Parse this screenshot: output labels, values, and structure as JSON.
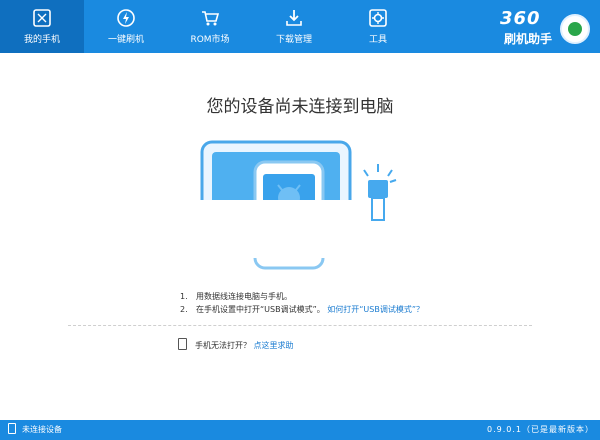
{
  "nav": {
    "tabs": [
      {
        "label": "我的手机",
        "icon": "phone-icon",
        "active": true
      },
      {
        "label": "一键刷机",
        "icon": "flash-icon",
        "active": false
      },
      {
        "label": "ROM市场",
        "icon": "cart-icon",
        "active": false
      },
      {
        "label": "下载管理",
        "icon": "download-icon",
        "active": false
      },
      {
        "label": "工具",
        "icon": "tools-icon",
        "active": false
      }
    ]
  },
  "brand": {
    "number": "360",
    "name": "刷机助手",
    "icon": "logo-icon"
  },
  "main": {
    "title": "您的设备尚未连接到电脑",
    "steps": [
      {
        "num": "1.",
        "text": "用数据线连接电脑与手机。",
        "link": ""
      },
      {
        "num": "2.",
        "text": "在手机设置中打开“USB调试模式”。",
        "link": "如何打开“USB调试模式”？"
      }
    ],
    "help_text": "手机无法打开？",
    "help_link": "点这里求助"
  },
  "status": {
    "left": "未连接设备",
    "right": "0.9.0.1（已是最新版本）"
  },
  "colors": {
    "accent": "#1a8ae0",
    "active_tab": "#0f6fbf",
    "link": "#1a7bd0"
  }
}
